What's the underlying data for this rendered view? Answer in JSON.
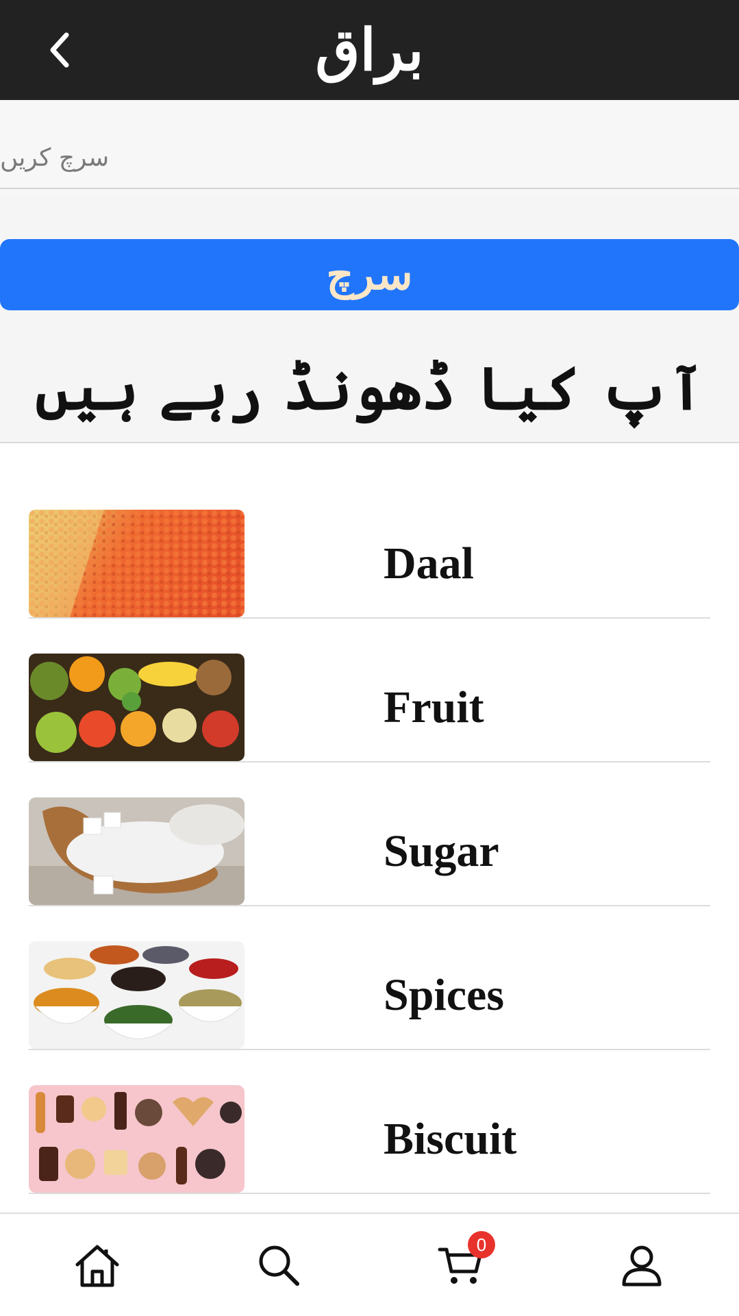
{
  "header": {
    "title": "براق",
    "back_icon": "chevron-left-icon"
  },
  "search": {
    "placeholder": "سرچ کریں",
    "value": "",
    "button_label": "سرچ"
  },
  "heading": "آپ کیا ڈھونڈ رہے ہیں",
  "categories": [
    {
      "label": "Daal",
      "image": "red-and-yellow-lentils"
    },
    {
      "label": "Fruit",
      "image": "assorted-fruits"
    },
    {
      "label": "Sugar",
      "image": "sugar-in-wooden-spoon"
    },
    {
      "label": "Spices",
      "image": "bowls-of-spices"
    },
    {
      "label": "Biscuit",
      "image": "assorted-biscuits"
    }
  ],
  "tabbar": {
    "items": [
      {
        "name": "home",
        "icon": "home-icon"
      },
      {
        "name": "search",
        "icon": "search-icon"
      },
      {
        "name": "cart",
        "icon": "cart-icon"
      },
      {
        "name": "profile",
        "icon": "user-icon"
      }
    ],
    "cart_count": "0"
  },
  "colors": {
    "header_bg": "#222222",
    "primary": "#2175fa",
    "search_button_text": "#fbe7c8",
    "badge": "#e8332c"
  }
}
